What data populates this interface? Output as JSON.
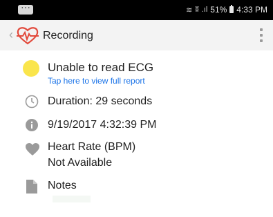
{
  "status_bar": {
    "battery": "51%",
    "time": "4:33 PM",
    "wifi_icon": "wifi-icon",
    "alarm_icon": "alarm-icon",
    "signal_icon": "signal-icon"
  },
  "app_bar": {
    "title": "Recording",
    "back_icon": "back-arrow-icon",
    "logo_icon": "heart-ecg-logo-icon",
    "menu_icon": "overflow-menu-icon"
  },
  "result": {
    "status_text": "Unable to read ECG",
    "link_text": "Tap here to view full report",
    "status_color": "#fae54c"
  },
  "duration": {
    "text": "Duration: 29 seconds",
    "icon": "clock-icon"
  },
  "timestamp": {
    "text": "9/19/2017 4:32:39 PM",
    "icon": "info-icon"
  },
  "heart_rate": {
    "label": "Heart Rate (BPM)",
    "value": "Not Available",
    "icon": "heart-icon"
  },
  "notes": {
    "label": "Notes",
    "icon": "document-icon"
  },
  "colors": {
    "accent_red": "#e2493b",
    "link_blue": "#1a73e8",
    "icon_gray": "#9a9a9a"
  }
}
